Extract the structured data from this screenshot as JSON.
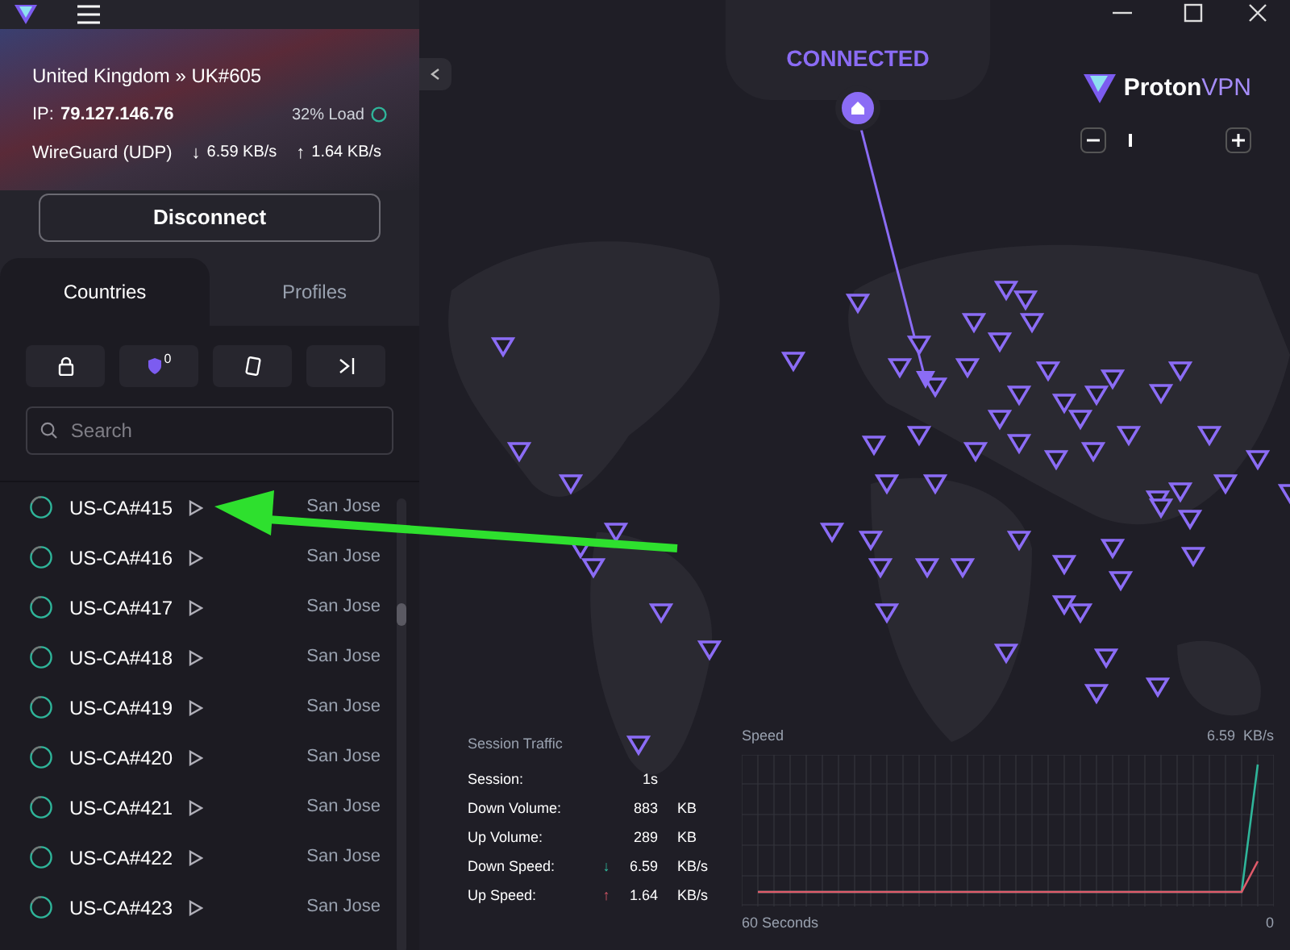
{
  "connection": {
    "location": "United Kingdom » UK#605",
    "ip_label": "IP:",
    "ip": "79.127.146.76",
    "load": "32% Load",
    "protocol": "WireGuard (UDP)",
    "down_arrow": "↓",
    "down": "6.59 KB/s",
    "up_arrow": "↑",
    "up": "1.64 KB/s"
  },
  "disconnect_button": "Disconnect",
  "tabs": [
    {
      "label": "Countries",
      "selected": true
    },
    {
      "label": "Profiles",
      "selected": false
    }
  ],
  "filter_badge": "0",
  "search": {
    "placeholder": "Search"
  },
  "servers": [
    {
      "name": "US-CA#415",
      "city": "San Jose"
    },
    {
      "name": "US-CA#416",
      "city": "San Jose"
    },
    {
      "name": "US-CA#417",
      "city": "San Jose"
    },
    {
      "name": "US-CA#418",
      "city": "San Jose"
    },
    {
      "name": "US-CA#419",
      "city": "San Jose"
    },
    {
      "name": "US-CA#420",
      "city": "San Jose"
    },
    {
      "name": "US-CA#421",
      "city": "San Jose"
    },
    {
      "name": "US-CA#422",
      "city": "San Jose"
    },
    {
      "name": "US-CA#423",
      "city": "San Jose"
    }
  ],
  "status": "CONNECTED",
  "logo": {
    "first": "Proton",
    "second": "VPN"
  },
  "zoom": {
    "level": 0.15
  },
  "session_traffic": {
    "title": "Session Traffic",
    "rows": [
      {
        "kind": "plain",
        "label": "Session:",
        "value": "1s"
      },
      {
        "kind": "plain",
        "label": "Down Volume:",
        "value": "883",
        "unit": "KB"
      },
      {
        "kind": "plain",
        "label": "Up Volume:",
        "value": "289",
        "unit": "KB"
      },
      {
        "kind": "down",
        "label": "Down Speed:",
        "arrow": "↓",
        "value": "6.59",
        "unit": "KB/s"
      },
      {
        "kind": "up",
        "label": "Up Speed:",
        "arrow": "↑",
        "value": "1.64",
        "unit": "KB/s"
      }
    ]
  },
  "speed_chart": {
    "title": "Speed",
    "max": "6.59  KB/s",
    "x_start": "60 Seconds",
    "x_end": "0"
  }
}
